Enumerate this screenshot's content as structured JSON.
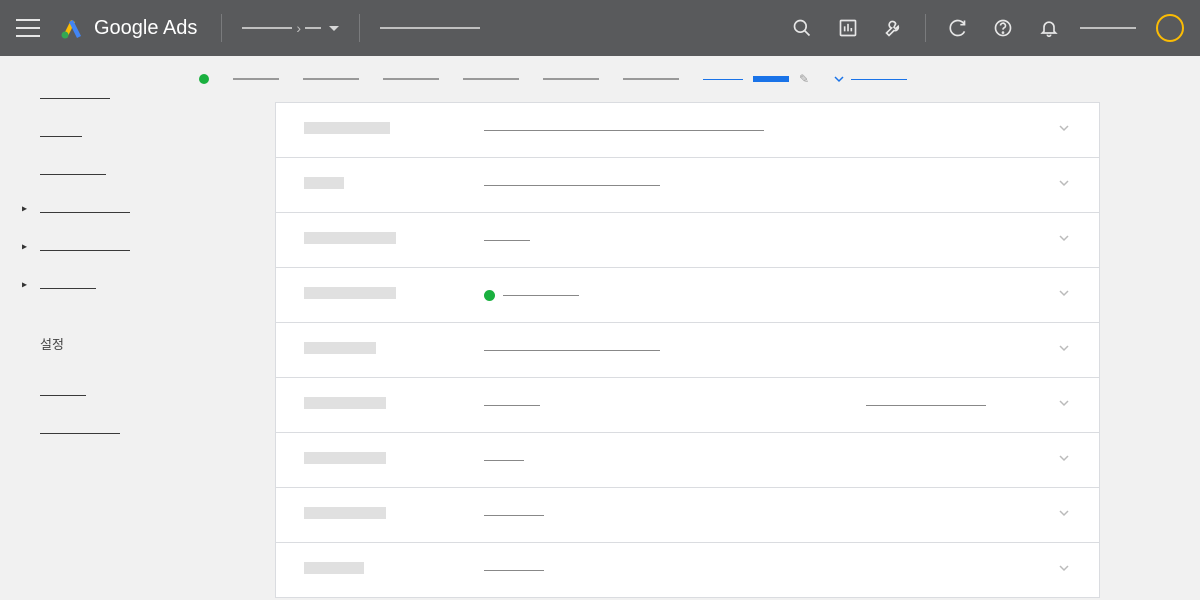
{
  "header": {
    "product_name": "Google Ads"
  },
  "sidebar": {
    "settings_label": "설정"
  },
  "panel": {
    "rows": [
      {
        "label_width": 86,
        "value_lines": [
          280
        ],
        "status": false,
        "col2": null
      },
      {
        "label_width": 40,
        "value_lines": [
          176
        ],
        "status": false,
        "col2": null
      },
      {
        "label_width": 92,
        "value_lines": [
          46
        ],
        "status": false,
        "col2": null
      },
      {
        "label_width": 92,
        "value_lines": [
          76
        ],
        "status": true,
        "col2": null
      },
      {
        "label_width": 72,
        "value_lines": [
          176
        ],
        "status": false,
        "col2": null
      },
      {
        "label_width": 82,
        "value_lines": [
          56
        ],
        "status": false,
        "col2": 120
      },
      {
        "label_width": 82,
        "value_lines": [
          40
        ],
        "status": false,
        "col2": null
      },
      {
        "label_width": 82,
        "value_lines": [
          60
        ],
        "status": false,
        "col2": null
      },
      {
        "label_width": 60,
        "value_lines": [
          60
        ],
        "status": false,
        "col2": null
      }
    ]
  }
}
